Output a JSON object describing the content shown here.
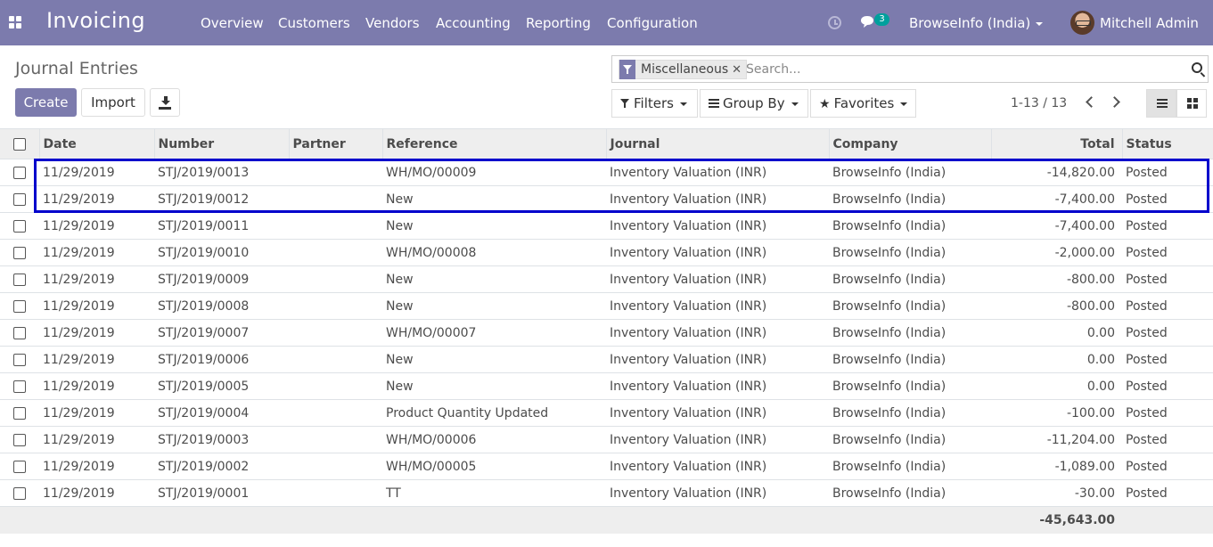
{
  "navbar": {
    "app_name": "Invoicing",
    "menu": [
      "Overview",
      "Customers",
      "Vendors",
      "Accounting",
      "Reporting",
      "Configuration"
    ],
    "chat_count": "3",
    "company": "BrowseInfo (India)",
    "user": "Mitchell Admin"
  },
  "control_panel": {
    "title": "Journal Entries",
    "create_label": "Create",
    "import_label": "Import",
    "search": {
      "facet": "Miscellaneous",
      "placeholder": "Search..."
    },
    "filters_label": "Filters",
    "groupby_label": "Group By",
    "favorites_label": "Favorites",
    "pager": "1-13 / 13"
  },
  "table": {
    "columns": [
      "Date",
      "Number",
      "Partner",
      "Reference",
      "Journal",
      "Company",
      "Total",
      "Status"
    ],
    "rows": [
      {
        "date": "11/29/2019",
        "number": "STJ/2019/0013",
        "partner": "",
        "reference": "WH/MO/00009",
        "journal": "Inventory Valuation (INR)",
        "company": "BrowseInfo (India)",
        "total": "-14,820.00",
        "status": "Posted"
      },
      {
        "date": "11/29/2019",
        "number": "STJ/2019/0012",
        "partner": "",
        "reference": "New",
        "journal": "Inventory Valuation (INR)",
        "company": "BrowseInfo (India)",
        "total": "-7,400.00",
        "status": "Posted"
      },
      {
        "date": "11/29/2019",
        "number": "STJ/2019/0011",
        "partner": "",
        "reference": "New",
        "journal": "Inventory Valuation (INR)",
        "company": "BrowseInfo (India)",
        "total": "-7,400.00",
        "status": "Posted"
      },
      {
        "date": "11/29/2019",
        "number": "STJ/2019/0010",
        "partner": "",
        "reference": "WH/MO/00008",
        "journal": "Inventory Valuation (INR)",
        "company": "BrowseInfo (India)",
        "total": "-2,000.00",
        "status": "Posted"
      },
      {
        "date": "11/29/2019",
        "number": "STJ/2019/0009",
        "partner": "",
        "reference": "New",
        "journal": "Inventory Valuation (INR)",
        "company": "BrowseInfo (India)",
        "total": "-800.00",
        "status": "Posted"
      },
      {
        "date": "11/29/2019",
        "number": "STJ/2019/0008",
        "partner": "",
        "reference": "New",
        "journal": "Inventory Valuation (INR)",
        "company": "BrowseInfo (India)",
        "total": "-800.00",
        "status": "Posted"
      },
      {
        "date": "11/29/2019",
        "number": "STJ/2019/0007",
        "partner": "",
        "reference": "WH/MO/00007",
        "journal": "Inventory Valuation (INR)",
        "company": "BrowseInfo (India)",
        "total": "0.00",
        "status": "Posted"
      },
      {
        "date": "11/29/2019",
        "number": "STJ/2019/0006",
        "partner": "",
        "reference": "New",
        "journal": "Inventory Valuation (INR)",
        "company": "BrowseInfo (India)",
        "total": "0.00",
        "status": "Posted"
      },
      {
        "date": "11/29/2019",
        "number": "STJ/2019/0005",
        "partner": "",
        "reference": "New",
        "journal": "Inventory Valuation (INR)",
        "company": "BrowseInfo (India)",
        "total": "0.00",
        "status": "Posted"
      },
      {
        "date": "11/29/2019",
        "number": "STJ/2019/0004",
        "partner": "",
        "reference": "Product Quantity Updated",
        "journal": "Inventory Valuation (INR)",
        "company": "BrowseInfo (India)",
        "total": "-100.00",
        "status": "Posted"
      },
      {
        "date": "11/29/2019",
        "number": "STJ/2019/0003",
        "partner": "",
        "reference": "WH/MO/00006",
        "journal": "Inventory Valuation (INR)",
        "company": "BrowseInfo (India)",
        "total": "-11,204.00",
        "status": "Posted"
      },
      {
        "date": "11/29/2019",
        "number": "STJ/2019/0002",
        "partner": "",
        "reference": "WH/MO/00005",
        "journal": "Inventory Valuation (INR)",
        "company": "BrowseInfo (India)",
        "total": "-1,089.00",
        "status": "Posted"
      },
      {
        "date": "11/29/2019",
        "number": "STJ/2019/0001",
        "partner": "",
        "reference": "TT",
        "journal": "Inventory Valuation (INR)",
        "company": "BrowseInfo (India)",
        "total": "-30.00",
        "status": "Posted"
      }
    ],
    "grand_total": "-45,643.00"
  },
  "colors": {
    "brand": "#7c7bad",
    "badge": "#00a09d",
    "highlight": "#0000cc"
  }
}
